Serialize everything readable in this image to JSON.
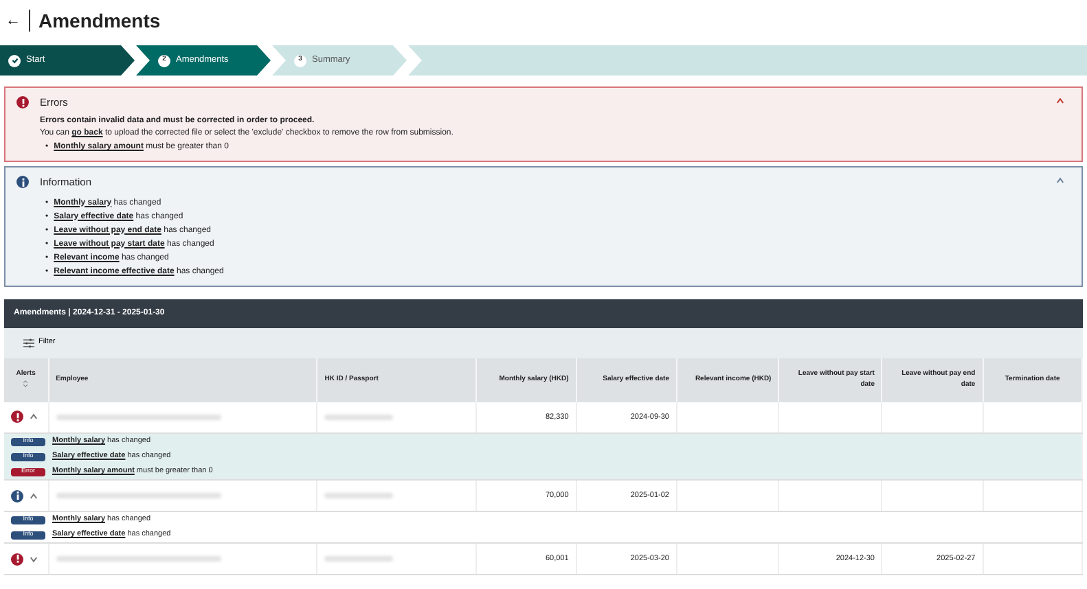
{
  "page": {
    "back": "←",
    "title": "Amendments"
  },
  "steps": [
    {
      "label": "Start",
      "completed": true,
      "selected": false
    },
    {
      "label": "Amendments",
      "number": "2",
      "completed": false,
      "selected": true
    },
    {
      "label": "Summary",
      "number": "3",
      "completed": false,
      "selected": false
    }
  ],
  "panels": [
    {
      "kind": "error",
      "bullet": "•",
      "title": "Errors",
      "expanded": true,
      "lead": "Errors contain invalid data and must be corrected in order to proceed.",
      "text_before": "You can",
      "link": "go back",
      "text_after": "to upload the corrected file or select the 'exclude' checkbox to remove the row from submission.",
      "items": [
        "**Monthly salary amount** must be greater than 0"
      ]
    },
    {
      "kind": "info",
      "bullet": "•",
      "title": "Information",
      "expanded": true,
      "items": [
        "**Monthly salary** has changed",
        "**Salary effective date** has changed",
        "**Leave without pay end date** has changed",
        "**Leave without pay start date** has changed",
        "**Relevant income** has changed",
        "**Relevant income effective date** has changed"
      ]
    }
  ],
  "table": {
    "title": "Amendments | 2024-12-31 - 2025-01-30",
    "filter": "Filter",
    "columns": [
      "Alerts",
      "Employee",
      "HK ID / Passport",
      "Monthly salary (HKD)",
      "Salary effective date",
      "Relevant income (HKD)",
      "Leave without pay start date",
      "Leave without pay end date",
      "Termination date"
    ],
    "rows": [
      {
        "error": true,
        "expanded": true,
        "monthly_salary": "82,330",
        "salary_effective_date": "2024-09-30",
        "messages": [
          {
            "kind": "info",
            "tag": "Info",
            "text": "**Monthly salary** has changed"
          },
          {
            "kind": "info",
            "tag": "Info",
            "text": "**Salary effective date** has changed"
          },
          {
            "kind": "error",
            "tag": "Error",
            "text": "**Monthly salary amount** must be greater than 0"
          }
        ]
      },
      {
        "error": false,
        "expanded": true,
        "monthly_salary": "70,000",
        "salary_effective_date": "2025-01-02",
        "messages": [
          {
            "kind": "info",
            "tag": "Info",
            "text": "**Monthly salary** has changed"
          },
          {
            "kind": "info",
            "tag": "Info",
            "text": "**Salary effective date** has changed"
          }
        ]
      },
      {
        "error": true,
        "expanded": false,
        "monthly_salary": "60,001",
        "salary_effective_date": "2025-03-20",
        "leave_without_pay_start_date": "2024-12-30",
        "leave_without_pay_end_date": "2025-02-27"
      }
    ]
  }
}
